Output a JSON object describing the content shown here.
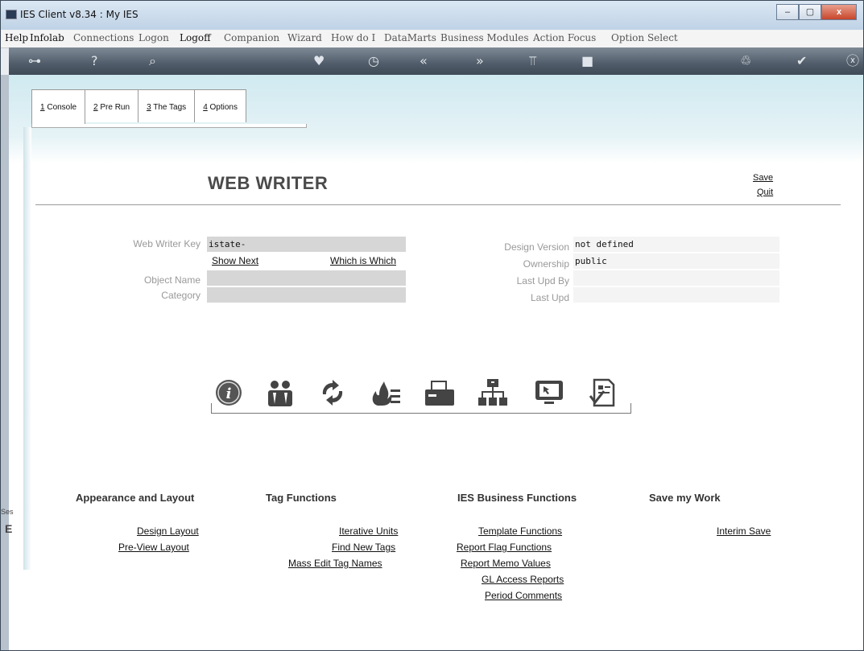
{
  "window": {
    "title": "IES Client v8.34 : My IES",
    "buttons": {
      "minimize": "–",
      "maximize": "▢",
      "close": "x"
    }
  },
  "menubar": {
    "items": [
      "Help",
      "Infolab",
      "Connections",
      "Logon",
      "Logoff",
      "Companion",
      "Wizard",
      "How do I",
      "DataMarts",
      "Business Modules",
      "Action Focus",
      "Option Select"
    ]
  },
  "toolbar": {
    "icons": [
      "key-icon",
      "help-icon",
      "search-icon",
      "heart-icon",
      "clock-icon",
      "rewind-icon",
      "forward-icon",
      "tools-icon",
      "stop-icon",
      "recycle-icon",
      "check-icon",
      "close-icon"
    ]
  },
  "tabs": [
    {
      "key": "1",
      "label": " Console"
    },
    {
      "key": "2",
      "label": " Pre Run"
    },
    {
      "key": "3",
      "label": " The Tags"
    },
    {
      "key": "4",
      "label": " Options"
    }
  ],
  "page": {
    "title": "WEB WRITER",
    "save": "Save",
    "quit": "Quit"
  },
  "form": {
    "web_writer_key_label": "Web Writer Key",
    "web_writer_key_value": "istate-",
    "show_next": "Show Next",
    "which_is_which": "Which is Which",
    "object_name_label": "Object Name",
    "object_name_value": "",
    "category_label": "Category",
    "category_value": "",
    "design_version_label": "Design Version",
    "design_version_value": "not defined",
    "ownership_label": "Ownership",
    "ownership_value": "public",
    "last_upd_by_label": "Last Upd By",
    "last_upd_by_value": "",
    "last_upd_label": "Last Upd",
    "last_upd_value": ""
  },
  "iconbar": {
    "icons": [
      "info-icon",
      "users-icon",
      "refresh-icon",
      "fire-list-icon",
      "folder-print-icon",
      "hierarchy-icon",
      "screen-icon",
      "checklist-icon"
    ]
  },
  "sections": {
    "appearance": {
      "title": "Appearance and Layout",
      "links": [
        "Design Layout",
        "Pre-View Layout"
      ]
    },
    "tag_functions": {
      "title": "Tag Functions",
      "links": [
        "Iterative Units",
        "Find New Tags",
        "Mass Edit Tag Names"
      ]
    },
    "business": {
      "title": "IES Business Functions",
      "links": [
        "Template Functions",
        "Report Flag Functions",
        "Report Memo Values",
        "GL Access Reports",
        "Period Comments"
      ]
    },
    "save_work": {
      "title": "Save my Work",
      "links": [
        "Interim Save"
      ]
    }
  },
  "bottom_left": {
    "ses": "Ses",
    "e": "E"
  }
}
